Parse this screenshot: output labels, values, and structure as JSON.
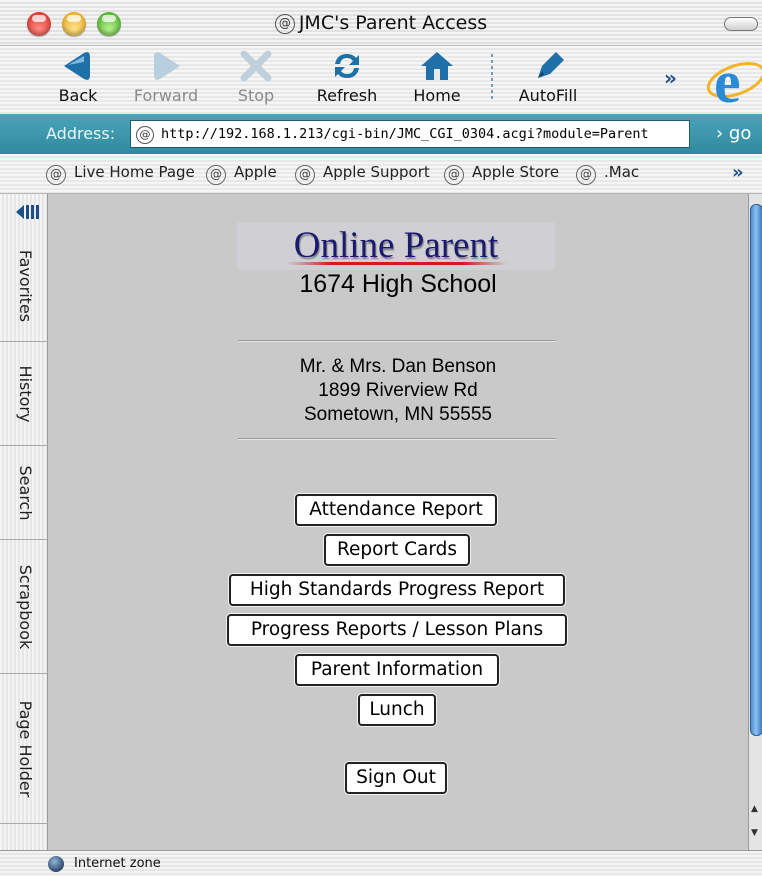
{
  "window": {
    "title": "JMC's Parent Access"
  },
  "toolbar": {
    "back": "Back",
    "forward": "Forward",
    "stop": "Stop",
    "refresh": "Refresh",
    "home": "Home",
    "autofill": "AutoFill",
    "more": "»"
  },
  "address": {
    "label": "Address:",
    "url": "http://192.168.1.213/cgi-bin/JMC_CGI_0304.acgi?module=Parent",
    "go": "› go"
  },
  "favorites": {
    "items": [
      "Live Home Page",
      "Apple",
      "Apple Support",
      "Apple Store",
      ".Mac"
    ],
    "more": "»"
  },
  "sidebar": {
    "tabs": [
      "Favorites",
      "History",
      "Search",
      "Scrapbook",
      "Page Holder"
    ]
  },
  "page": {
    "logo": "Online Parent",
    "school": "1674 High School",
    "address_lines": [
      "Mr. & Mrs. Dan Benson",
      "1899 Riverview Rd",
      "Sometown, MN 55555"
    ],
    "buttons": [
      "Attendance Report",
      "Report Cards",
      "High Standards Progress Report",
      "Progress Reports / Lesson Plans",
      "Parent Information",
      "Lunch"
    ],
    "sign_out": "Sign Out"
  },
  "status": {
    "zone": "Internet zone"
  },
  "colors": {
    "address_bar": "#2f8aa0",
    "content_bg": "#c9c9c9",
    "logo_text": "#1a1a6e",
    "toolbar_icon": "#1f6fa8"
  }
}
